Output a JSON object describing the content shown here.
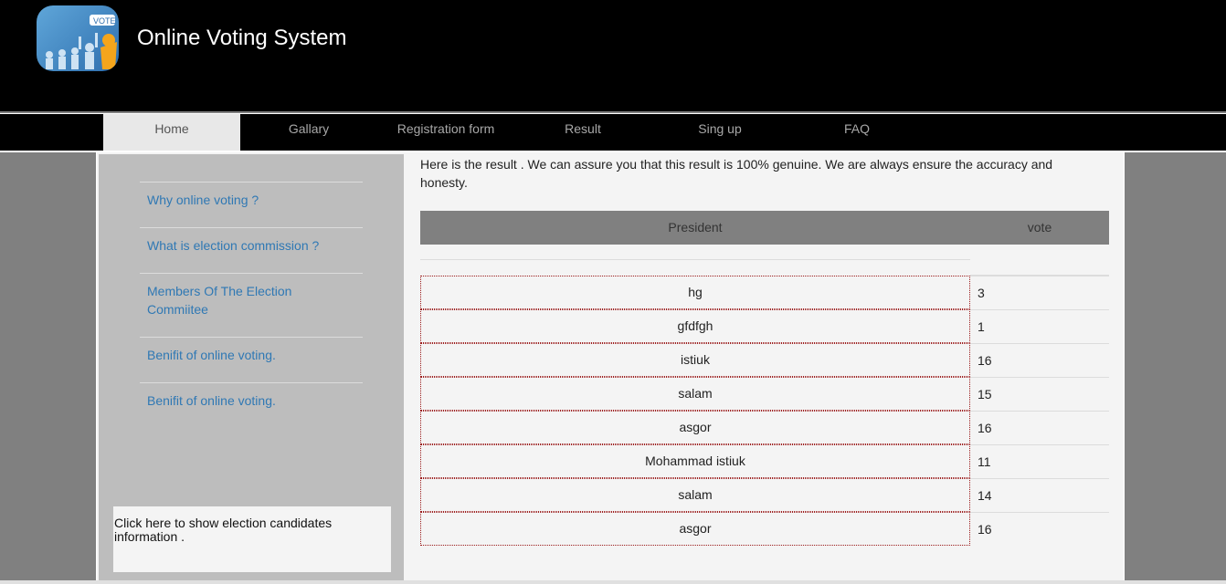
{
  "header": {
    "title": "Online Voting System",
    "logo_badge": "VOTE",
    "logo_icon": "vote-logo-icon"
  },
  "nav": {
    "items": [
      {
        "label": "Home",
        "active": true
      },
      {
        "label": "Gallary",
        "active": false
      },
      {
        "label": "Registration form",
        "active": false
      },
      {
        "label": "Result",
        "active": false
      },
      {
        "label": "Sing up",
        "active": false
      },
      {
        "label": "FAQ",
        "active": false
      }
    ]
  },
  "sidebar": {
    "links": [
      {
        "label": "Why online voting ?"
      },
      {
        "label": "What is election commission ?"
      },
      {
        "label": "Members Of The Election Commiitee"
      },
      {
        "label": "Benifit of online voting."
      },
      {
        "label": "Benifit of online voting."
      }
    ],
    "candidates_box": "Click here to show election candidates information ."
  },
  "main": {
    "intro": "Here is the result . We can assure you that this result is 100% genuine. We are always ensure the accuracy and honesty.",
    "table": {
      "headers": {
        "president": "President",
        "vote": "vote"
      },
      "rows": [
        {
          "name": "hg",
          "votes": "3"
        },
        {
          "name": "gfdfgh",
          "votes": "1"
        },
        {
          "name": "istiuk",
          "votes": "16"
        },
        {
          "name": "salam",
          "votes": "15"
        },
        {
          "name": "asgor",
          "votes": "16"
        },
        {
          "name": "Mohammad istiuk",
          "votes": "11"
        },
        {
          "name": "salam",
          "votes": "14"
        },
        {
          "name": "asgor",
          "votes": "16"
        }
      ]
    }
  },
  "colors": {
    "header_bg": "#000000",
    "page_bg": "#808080",
    "content_bg": "#f4f4f4",
    "sidebar_bg": "#bdbdbd",
    "link": "#2f78b4",
    "table_head": "#808080",
    "cell_border": "#9b1b1b"
  }
}
